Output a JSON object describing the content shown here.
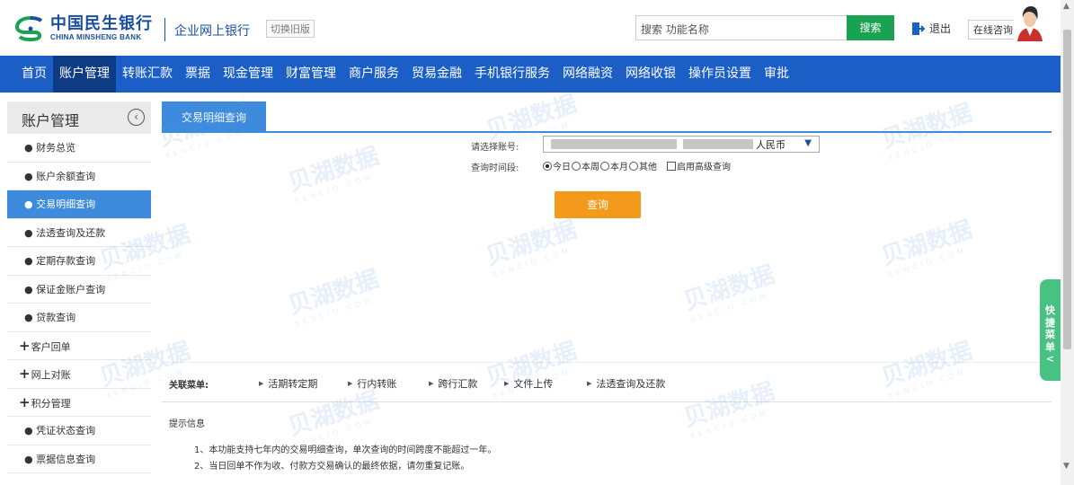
{
  "header": {
    "logo_cn": "中国民生银行",
    "logo_en": "CHINA MINSHENG BANK",
    "corp_title": "企业网上银行",
    "switch_old": "切换旧版",
    "search_placeholder": "搜索 功能名称",
    "search_button": "搜索",
    "logout": "退出",
    "online_consult": "在线咨询"
  },
  "nav": {
    "items": [
      "首页",
      "账户管理",
      "转账汇款",
      "票据",
      "现金管理",
      "财富管理",
      "商户服务",
      "贸易金融",
      "手机银行服务",
      "网络融资",
      "网络收银",
      "操作员设置",
      "审批"
    ],
    "active_index": 1
  },
  "sidebar": {
    "title": "账户管理",
    "items": [
      {
        "label": "● 财务总览",
        "type": "item"
      },
      {
        "label": "● 账户余额查询",
        "type": "item"
      },
      {
        "label": "● 交易明细查询",
        "type": "item",
        "active": true
      },
      {
        "label": "● 法透查询及还款",
        "type": "item"
      },
      {
        "label": "● 定期存款查询",
        "type": "item"
      },
      {
        "label": "● 保证金账户查询",
        "type": "item"
      },
      {
        "label": "● 贷款查询",
        "type": "item"
      },
      {
        "label": "客户回单",
        "type": "group"
      },
      {
        "label": "网上对账",
        "type": "group"
      },
      {
        "label": "积分管理",
        "type": "group"
      },
      {
        "label": "● 凭证状态查询",
        "type": "item"
      },
      {
        "label": "● 票据信息查询",
        "type": "item"
      }
    ]
  },
  "main": {
    "tab_label": "交易明细查询",
    "account_label": "请选择账号:",
    "currency": "人民币",
    "period_label": "查询时间段:",
    "period_options": [
      "今日",
      "本周",
      "本月",
      "其他"
    ],
    "period_selected": "今日",
    "advanced_query": "启用高级查询",
    "query_button": "查询",
    "related_label": "关联菜单:",
    "related_links": [
      "活期转定期",
      "行内转账",
      "跨行汇款",
      "文件上传",
      "法透查询及还款"
    ],
    "tips_title": "提示信息",
    "tips": [
      "1、本功能支持七年内的交易明细查询，单次查询的时间跨度不能超过一年。",
      "2、当日回单不作为收、付款方交易确认的最终依据，请勿重复记账。"
    ]
  },
  "quick_menu": {
    "label_chars": [
      "快",
      "捷",
      "菜",
      "单",
      "<"
    ]
  },
  "colors": {
    "nav_bg": "#1b5fc6",
    "nav_active": "#0d3b84",
    "accent": "#3e8bdd",
    "search_btn": "#1aa253",
    "query_btn": "#f39a1b",
    "quick_menu": "#48c283"
  }
}
